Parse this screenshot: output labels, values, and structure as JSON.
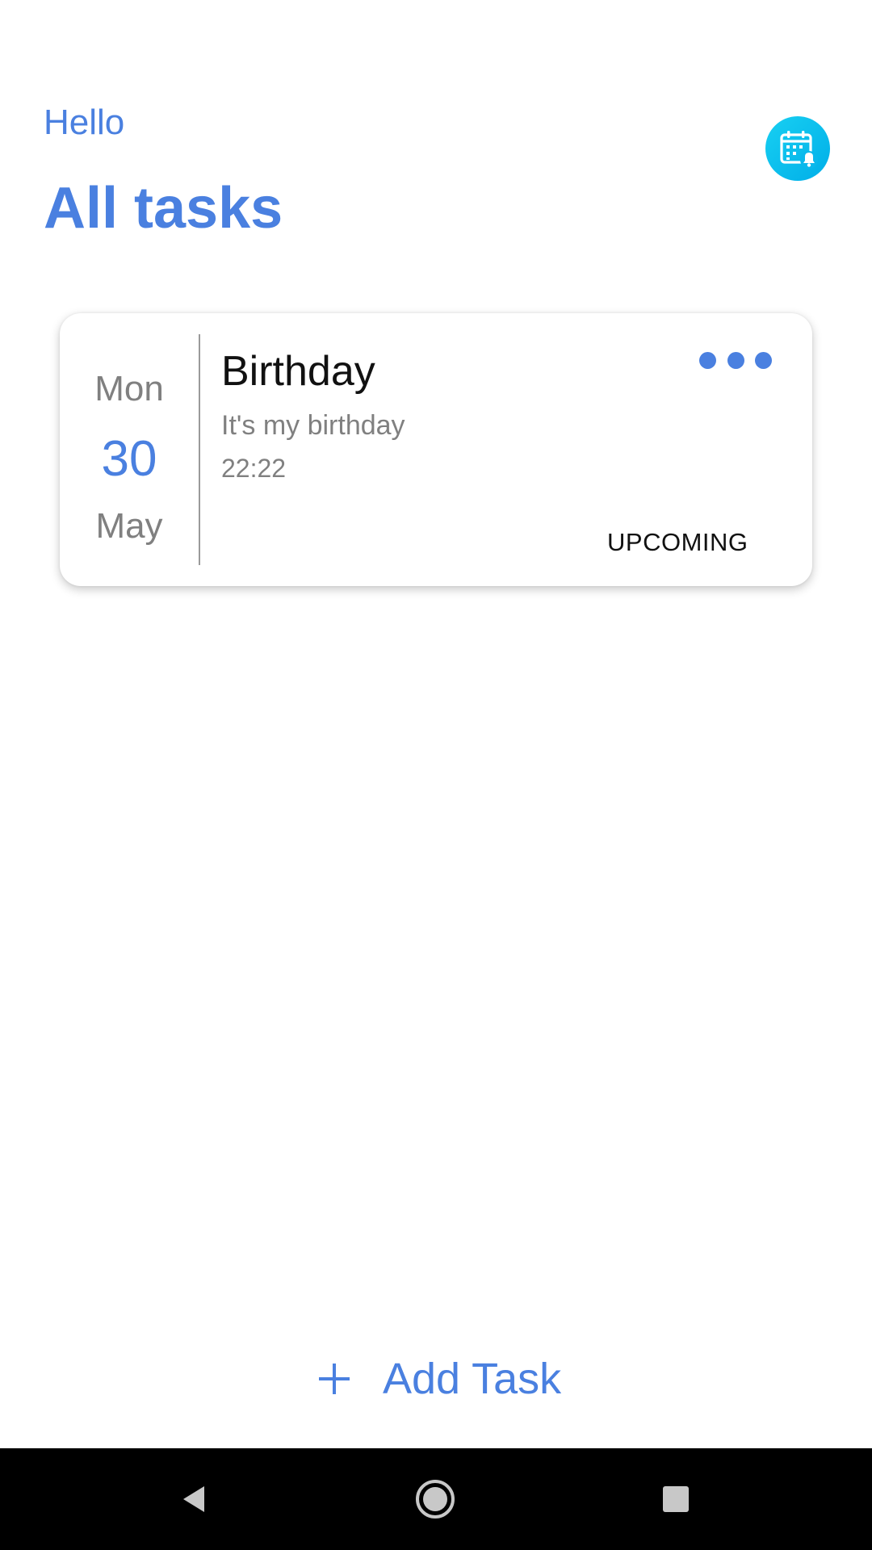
{
  "header": {
    "greeting": "Hello",
    "title": "All tasks",
    "calendar_icon": "calendar-bell-icon"
  },
  "tasks": [
    {
      "day_of_week": "Mon",
      "day": "30",
      "month": "May",
      "title": "Birthday",
      "description": "It's my birthday",
      "time": "22:22",
      "status": "UPCOMING",
      "menu_icon": "more-dots-icon"
    }
  ],
  "footer": {
    "add_label": "Add Task",
    "add_icon": "plus-icon"
  },
  "system_nav": {
    "back_icon": "back-triangle-icon",
    "home_icon": "home-circle-icon",
    "recents_icon": "recents-square-icon"
  },
  "colors": {
    "accent": "#4a80e0",
    "icon_gradient_start": "#18d0f2",
    "icon_gradient_end": "#00aee8",
    "muted_text": "#808080",
    "nav_bar": "#000000"
  }
}
